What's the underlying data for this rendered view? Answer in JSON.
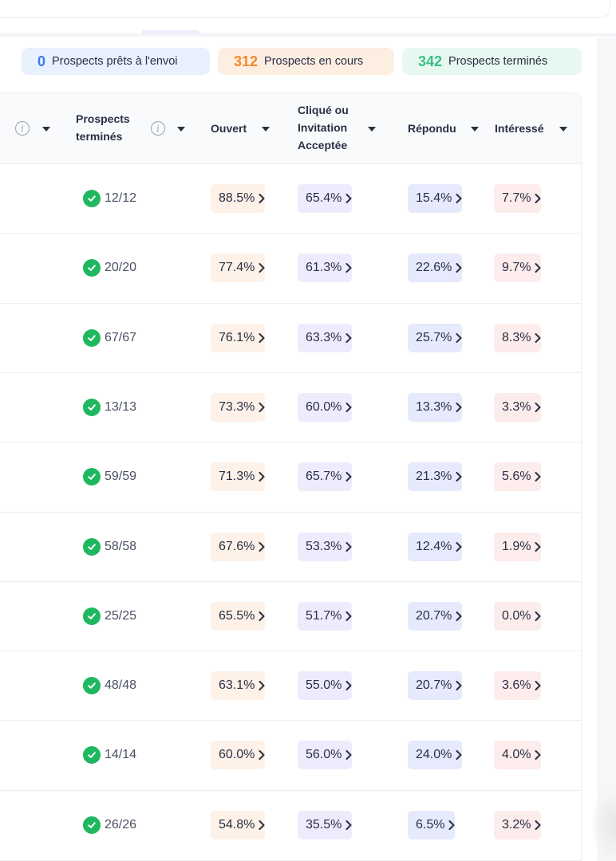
{
  "status": {
    "ready": {
      "count": "0",
      "label": "Prospects prêts à l'envoi"
    },
    "in_progress": {
      "count": "312",
      "label": "Prospects en cours"
    },
    "finished": {
      "count": "342",
      "label": "Prospects terminés"
    }
  },
  "columns": {
    "finished": "Prospects terminés",
    "opened": "Ouvert",
    "clicked": "Cliqué ou Invitation Acceptée",
    "replied": "Répondu",
    "interested": "Intéressé"
  },
  "colors": {
    "ready_accent": "#3a7be8",
    "in_progress_accent": "#ef8a2a",
    "finished_accent": "#3cbf86",
    "check_green": "#1fb75f"
  },
  "rows": [
    {
      "finished": "12/12",
      "opened": "88.5%",
      "clicked": "65.4%",
      "replied": "15.4%",
      "interested": "7.7%"
    },
    {
      "finished": "20/20",
      "opened": "77.4%",
      "clicked": "61.3%",
      "replied": "22.6%",
      "interested": "9.7%"
    },
    {
      "finished": "67/67",
      "opened": "76.1%",
      "clicked": "63.3%",
      "replied": "25.7%",
      "interested": "8.3%"
    },
    {
      "finished": "13/13",
      "opened": "73.3%",
      "clicked": "60.0%",
      "replied": "13.3%",
      "interested": "3.3%"
    },
    {
      "finished": "59/59",
      "opened": "71.3%",
      "clicked": "65.7%",
      "replied": "21.3%",
      "interested": "5.6%"
    },
    {
      "finished": "58/58",
      "opened": "67.6%",
      "clicked": "53.3%",
      "replied": "12.4%",
      "interested": "1.9%"
    },
    {
      "finished": "25/25",
      "opened": "65.5%",
      "clicked": "51.7%",
      "replied": "20.7%",
      "interested": "0.0%"
    },
    {
      "finished": "48/48",
      "opened": "63.1%",
      "clicked": "55.0%",
      "replied": "20.7%",
      "interested": "3.6%"
    },
    {
      "finished": "14/14",
      "opened": "60.0%",
      "clicked": "56.0%",
      "replied": "24.0%",
      "interested": "4.0%"
    },
    {
      "finished": "26/26",
      "opened": "54.8%",
      "clicked": "35.5%",
      "replied": "6.5%",
      "interested": "3.2%"
    }
  ]
}
